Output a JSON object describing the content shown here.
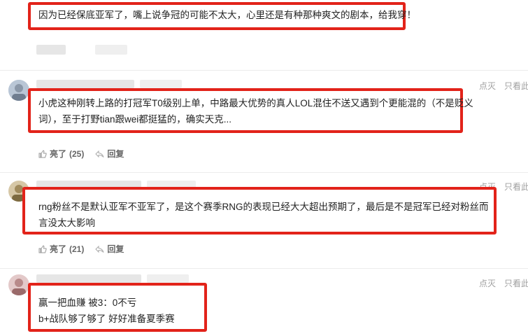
{
  "comments": [
    {
      "text_lines": [
        "因为已经保底亚军了，嘴上说争冠的可能不太大，心里还是有种那种爽文的剧本，给我穿！"
      ]
    },
    {
      "text_lines": [
        "小虎这种刚转上路的打冠军T0级别上单，中路最大优势的真人LOL混住不送又遇到个更能混的（不是贬义",
        "词），至于打野tian跟wei都挺猛的，确实天克..."
      ],
      "like_label": "亮了",
      "like_count": "(25)",
      "reply_label": "回复",
      "right_actions": [
        "点灭",
        "只看此人"
      ]
    },
    {
      "text_lines": [
        "rng粉丝不是默认亚军不亚军了，是这个赛季RNG的表现已经大大超出预期了，最后是不是冠军已经对粉丝而",
        "言没太大影响"
      ],
      "like_label": "亮了",
      "like_count": "(21)",
      "reply_label": "回复",
      "right_actions": [
        "点灭",
        "只看此人"
      ]
    },
    {
      "text_lines": [
        "赢一把血赚 被3：0不亏",
        "b+战队够了够了 好好准备夏季赛"
      ],
      "right_actions": [
        "点灭",
        "只看此人"
      ]
    }
  ],
  "colors": {
    "highlight_border": "#e2231a",
    "divider": "#ececec",
    "muted": "#999999"
  },
  "icons": {
    "like": "thumb-up-icon",
    "reply": "reply-arrow-icon"
  }
}
